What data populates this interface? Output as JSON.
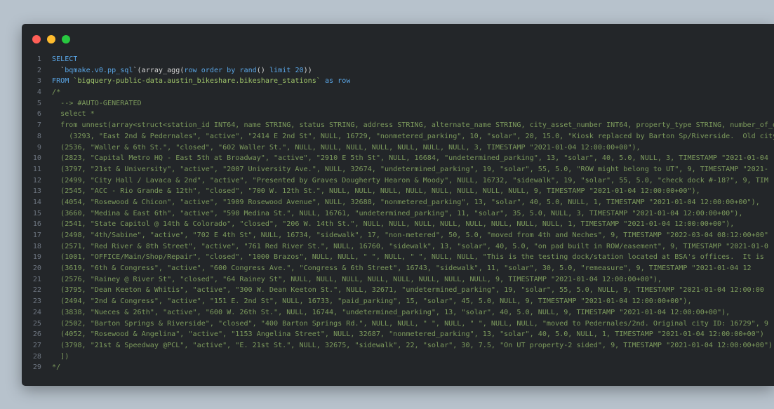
{
  "window": {
    "controls": [
      "close",
      "minimize",
      "maximize"
    ]
  },
  "colors": {
    "background": "#b7c2cc",
    "editor": "#232629",
    "keyword": "#5aa6e6",
    "string": "#9fc46a",
    "comment": "#7c9a5c",
    "line_number": "#6e7681"
  },
  "code": {
    "lines": [
      {
        "num": "1",
        "segments": [
          {
            "t": "SELECT",
            "c": "kw"
          }
        ]
      },
      {
        "num": "2",
        "segments": [
          {
            "t": "  `",
            "c": "pl"
          },
          {
            "t": "bqmake.v0.pp_sql",
            "c": "kw"
          },
          {
            "t": "`(array_agg(",
            "c": "pl"
          },
          {
            "t": "row",
            "c": "kw"
          },
          {
            "t": " ",
            "c": "pl"
          },
          {
            "t": "order by",
            "c": "kw"
          },
          {
            "t": " ",
            "c": "pl"
          },
          {
            "t": "rand",
            "c": "kw"
          },
          {
            "t": "() ",
            "c": "pl"
          },
          {
            "t": "limit",
            "c": "kw"
          },
          {
            "t": " ",
            "c": "pl"
          },
          {
            "t": "20",
            "c": "kw"
          },
          {
            "t": "))",
            "c": "pl"
          }
        ]
      },
      {
        "num": "3",
        "segments": [
          {
            "t": "FROM",
            "c": "kw"
          },
          {
            "t": " ",
            "c": "pl"
          },
          {
            "t": "`bigquery-public-data.austin_bikeshare.bikeshare_stations`",
            "c": "str"
          },
          {
            "t": " ",
            "c": "pl"
          },
          {
            "t": "as",
            "c": "kw"
          },
          {
            "t": " ",
            "c": "pl"
          },
          {
            "t": "row",
            "c": "kw"
          }
        ]
      },
      {
        "num": "4",
        "segments": [
          {
            "t": "/*",
            "c": "cm"
          }
        ]
      },
      {
        "num": "5",
        "segments": [
          {
            "t": "  --> #AUTO-GENERATED",
            "c": "cm"
          }
        ]
      },
      {
        "num": "6",
        "segments": [
          {
            "t": "  select *",
            "c": "cm"
          }
        ]
      },
      {
        "num": "7",
        "segments": [
          {
            "t": "  from unnest(array<struct<station_id INT64, name STRING, status STRING, address STRING, alternate_name STRING, city_asset_number INT64, property_type STRING, number_of_docks INT64, power_type STRING",
            "c": "cm"
          }
        ]
      },
      {
        "num": "8",
        "segments": [
          {
            "t": "    (3293, \"East 2nd & Pedernales\", \"active\", \"2414 E 2nd St\", NULL, 16729, \"nonmetered_parking\", 10, \"solar\", 20, 15.0, \"Kiosk replaced by Barton Sp/Riverside.  Old city",
            "c": "cm"
          }
        ]
      },
      {
        "num": "9",
        "segments": [
          {
            "t": "  (2536, \"Waller & 6th St.\", \"closed\", \"602 Waller St.\", NULL, NULL, NULL, NULL, NULL, NULL, NULL, 3, TIMESTAMP \"2021-01-04 12:00:00+00\"),",
            "c": "cm"
          }
        ]
      },
      {
        "num": "10",
        "segments": [
          {
            "t": "  (2823, \"Capital Metro HQ - East 5th at Broadway\", \"active\", \"2910 E 5th St\", NULL, 16684, \"undetermined_parking\", 13, \"solar\", 40, 5.0, NULL, 3, TIMESTAMP \"2021-01-04",
            "c": "cm"
          }
        ]
      },
      {
        "num": "11",
        "segments": [
          {
            "t": "  (3797, \"21st & University\", \"active\", \"2007 University Ave.\", NULL, 32674, \"undetermined_parking\", 19, \"solar\", 55, 5.0, \"ROW might belong to UT\", 9, TIMESTAMP \"2021-",
            "c": "cm"
          }
        ]
      },
      {
        "num": "12",
        "segments": [
          {
            "t": "  (2499, \"City Hall / Lavaca & 2nd\", \"active\", \"Presented by Graves Dougherty Hearon & Moody\", NULL, 16732, \"sidewalk\", 19, \"solar\", 55, 5.0, \"check dock #-18?\", 9, TIM",
            "c": "cm"
          }
        ]
      },
      {
        "num": "13",
        "segments": [
          {
            "t": "  (2545, \"ACC - Rio Grande & 12th\", \"closed\", \"700 W. 12th St.\", NULL, NULL, NULL, NULL, NULL, NULL, NULL, NULL, 9, TIMESTAMP \"2021-01-04 12:00:00+00\"),",
            "c": "cm"
          }
        ]
      },
      {
        "num": "14",
        "segments": [
          {
            "t": "  (4054, \"Rosewood & Chicon\", \"active\", \"1909 Rosewood Avenue\", NULL, 32688, \"nonmetered_parking\", 13, \"solar\", 40, 5.0, NULL, 1, TIMESTAMP \"2021-01-04 12:00:00+00\"),",
            "c": "cm"
          }
        ]
      },
      {
        "num": "15",
        "segments": [
          {
            "t": "  (3660, \"Medina & East 6th\", \"active\", \"590 Medina St.\", NULL, 16761, \"undetermined_parking\", 11, \"solar\", 35, 5.0, NULL, 3, TIMESTAMP \"2021-01-04 12:00:00+00\"),",
            "c": "cm"
          }
        ]
      },
      {
        "num": "16",
        "segments": [
          {
            "t": "  (2541, \"State Capitol @ 14th & Colorado\", \"closed\", \"206 W. 14th St.\", NULL, NULL, NULL, NULL, NULL, NULL, NULL, NULL, 1, TIMESTAMP \"2021-01-04 12:00:00+00\"),",
            "c": "cm"
          }
        ]
      },
      {
        "num": "17",
        "segments": [
          {
            "t": "  (2498, \"4th/Sabine\", \"active\", \"702 E 4th St\", NULL, 16734, \"sidewalk\", 17, \"non-metered\", 50, 5.0, \"moved from 4th and Neches\", 9, TIMESTAMP \"2022-03-04 08:12:00+00\"",
            "c": "cm"
          }
        ]
      },
      {
        "num": "18",
        "segments": [
          {
            "t": "  (2571, \"Red River & 8th Street\", \"active\", \"761 Red River St.\", NULL, 16760, \"sidewalk\", 13, \"solar\", 40, 5.0, \"on pad built in ROW/easement\", 9, TIMESTAMP \"2021-01-0",
            "c": "cm"
          }
        ]
      },
      {
        "num": "19",
        "segments": [
          {
            "t": "  (1001, \"OFFICE/Main/Shop/Repair\", \"closed\", \"1000 Brazos\", NULL, NULL, \" \", NULL, \" \", NULL, NULL, \"This is the testing dock/station located at BSA's offices.  It is",
            "c": "cm"
          }
        ]
      },
      {
        "num": "20",
        "segments": [
          {
            "t": "  (3619, \"6th & Congress\", \"active\", \"600 Congress Ave.\", \"Congress & 6th Street\", 16743, \"sidewalk\", 11, \"solar\", 30, 5.0, \"remeasure\", 9, TIMESTAMP \"2021-01-04 12",
            "c": "cm"
          }
        ]
      },
      {
        "num": "21",
        "segments": [
          {
            "t": "  (2576, \"Rainey @ River St\", \"closed\", \"64 Rainey St\", NULL, NULL, NULL, NULL, NULL, NULL, NULL, NULL, 9, TIMESTAMP \"2021-01-04 12:00:00+00\"),",
            "c": "cm"
          }
        ]
      },
      {
        "num": "22",
        "segments": [
          {
            "t": "  (3795, \"Dean Keeton & Whitis\", \"active\", \"300 W. Dean Keeton St.\", NULL, 32671, \"undetermined_parking\", 19, \"solar\", 55, 5.0, NULL, 9, TIMESTAMP \"2021-01-04 12:00:00",
            "c": "cm"
          }
        ]
      },
      {
        "num": "23",
        "segments": [
          {
            "t": "  (2494, \"2nd & Congress\", \"active\", \"151 E. 2nd St\", NULL, 16733, \"paid_parking\", 15, \"solar\", 45, 5.0, NULL, 9, TIMESTAMP \"2021-01-04 12:00:00+00\"),",
            "c": "cm"
          }
        ]
      },
      {
        "num": "24",
        "segments": [
          {
            "t": "  (3838, \"Nueces & 26th\", \"active\", \"600 W. 26th St.\", NULL, 16744, \"undetermined_parking\", 13, \"solar\", 40, 5.0, NULL, 9, TIMESTAMP \"2021-01-04 12:00:00+00\"),",
            "c": "cm"
          }
        ]
      },
      {
        "num": "25",
        "segments": [
          {
            "t": "  (2502, \"Barton Springs & Riverside\", \"closed\", \"400 Barton Springs Rd.\", NULL, NULL, \" \", NULL, \" \", NULL, NULL, \"moved to Pedernales/2nd. Original city ID: 16729\", 9",
            "c": "cm"
          }
        ]
      },
      {
        "num": "26",
        "segments": [
          {
            "t": "  (4052, \"Rosewood & Angelina\", \"active\", \"1153 Angelina Street\", NULL, 32687, \"nonmetered_parking\", 13, \"solar\", 40, 5.0, NULL, 1, TIMESTAMP \"2021-01-04 12:00:00+00\")",
            "c": "cm"
          }
        ]
      },
      {
        "num": "27",
        "segments": [
          {
            "t": "  (3798, \"21st & Speedway @PCL\", \"active\", \"E. 21st St.\", NULL, 32675, \"sidewalk\", 22, \"solar\", 30, 7.5, \"On UT property-2 sided\", 9, TIMESTAMP \"2021-01-04 12:00:00+00\"),",
            "c": "cm"
          }
        ]
      },
      {
        "num": "28",
        "segments": [
          {
            "t": "  ])",
            "c": "cm"
          }
        ]
      },
      {
        "num": "29",
        "segments": [
          {
            "t": "*/",
            "c": "cm"
          }
        ]
      }
    ]
  }
}
